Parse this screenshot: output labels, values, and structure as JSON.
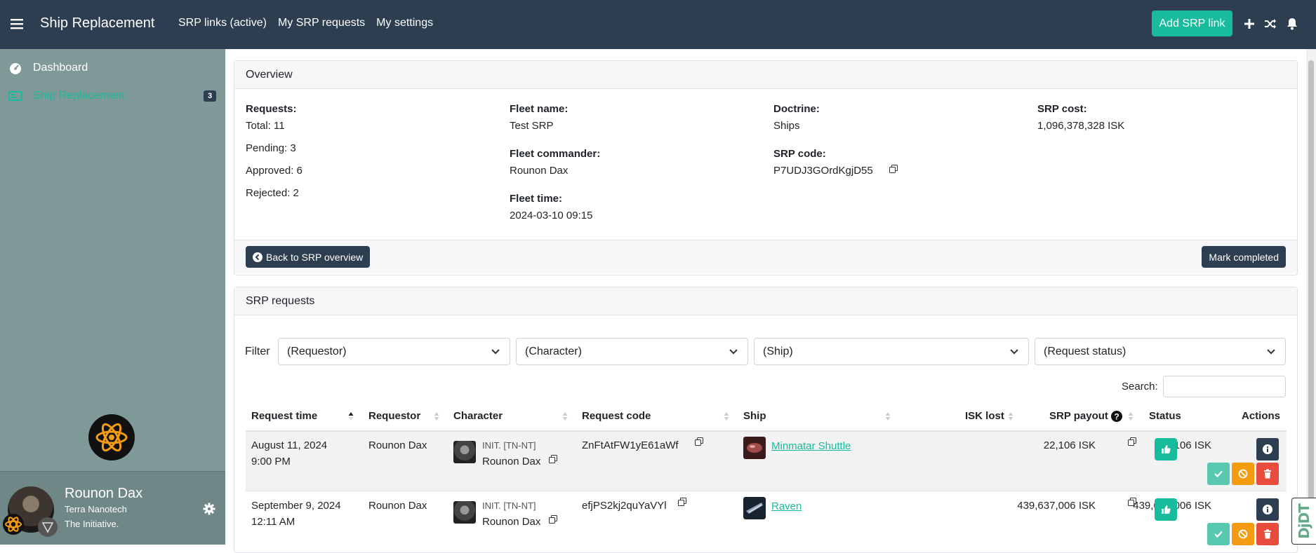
{
  "app": {
    "title": "Ship Replacement"
  },
  "topnav": {
    "links": [
      "SRP links (active)",
      "My SRP requests",
      "My settings"
    ],
    "add_button": "Add SRP link"
  },
  "sidebar": {
    "items": [
      {
        "label": "Dashboard",
        "icon": "dashboard-icon"
      },
      {
        "label": "Ship Replacement",
        "icon": "srp-icon",
        "badge": "3",
        "active": true
      }
    ],
    "user": {
      "name": "Rounon Dax",
      "corp": "Terra Nanotech",
      "alliance": "The Initiative."
    }
  },
  "overview": {
    "header": "Overview",
    "requests_label": "Requests:",
    "total": "Total: 11",
    "pending": "Pending: 3",
    "approved": "Approved: 6",
    "rejected": "Rejected: 2",
    "fleet_name_label": "Fleet name:",
    "fleet_name": "Test SRP",
    "fc_label": "Fleet commander:",
    "fc": "Rounon Dax",
    "fleet_time_label": "Fleet time:",
    "fleet_time": "2024-03-10 09:15",
    "doctrine_label": "Doctrine:",
    "doctrine": "Ships",
    "srp_code_label": "SRP code:",
    "srp_code": "P7UDJ3GOrdKgjD55",
    "srp_cost_label": "SRP cost:",
    "srp_cost": "1,096,378,328 ISK",
    "back_button": "Back to SRP overview",
    "complete_button": "Mark completed"
  },
  "requests": {
    "header": "SRP requests",
    "filter_label": "Filter",
    "filters": [
      "(Requestor)",
      "(Character)",
      "(Ship)",
      "(Request status)"
    ],
    "search_label": "Search:",
    "columns": [
      "Request time",
      "Requestor",
      "Character",
      "Request code",
      "Ship",
      "ISK lost",
      "SRP payout",
      "Status",
      "Actions"
    ],
    "rows": [
      {
        "time_date": "August 11, 2024",
        "time_clock": "9:00 PM",
        "requestor": "Rounon Dax",
        "char_corp": "INIT. [TN-NT]",
        "char_name": "Rounon Dax",
        "code": "ZnFtAtFW1yE61aWf",
        "ship": "Minmatar Shuttle",
        "isk_lost": "22,106 ISK",
        "payout": "22,106 ISK"
      },
      {
        "time_date": "September 9, 2024",
        "time_clock": "12:11 AM",
        "requestor": "Rounon Dax",
        "char_corp": "INIT. [TN-NT]",
        "char_name": "Rounon Dax",
        "code": "efjPS2kj2quYaVYl",
        "ship": "Raven",
        "isk_lost": "439,637,006 ISK",
        "payout": "439,637,006 ISK"
      }
    ]
  },
  "debug_toolbar": {
    "label": "DjDT"
  },
  "colors": {
    "navbar": "#2c3e50",
    "sidebar": "#7f9998",
    "accent": "#18bc9c",
    "warning": "#f39c12",
    "danger": "#e74c3c"
  }
}
